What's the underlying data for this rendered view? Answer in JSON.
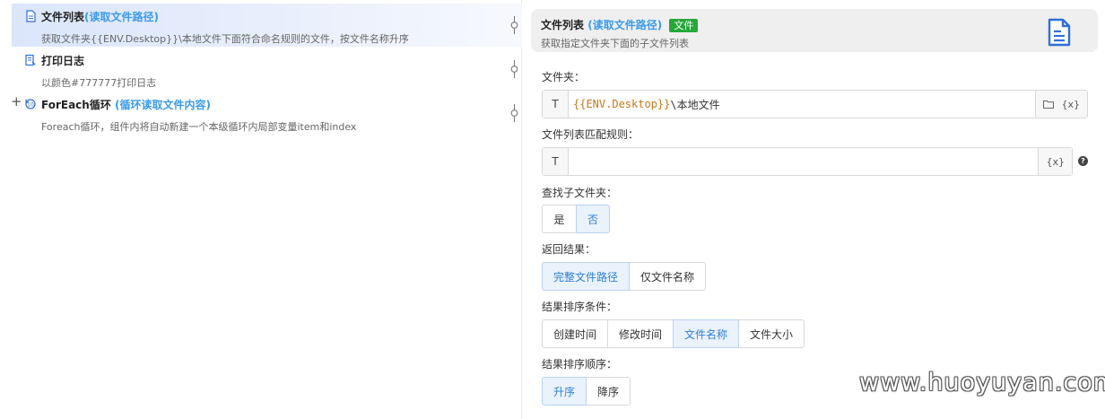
{
  "steps": [
    {
      "title": "文件列表",
      "title_hl": "(读取文件路径)",
      "desc": "获取文件夹{{ENV.Desktop}}\\本地文件下面符合命名规则的文件，按文件名称升序",
      "icon": "file-list-icon",
      "selected": true
    },
    {
      "title": "打印日志",
      "title_hl": "",
      "desc": "以颜色#777777打印日志",
      "icon": "print-log-icon",
      "selected": false
    },
    {
      "title": "ForEach循环",
      "title_hl": " (循环读取文件内容)",
      "desc": "Foreach循环，组件内将自动新建一个本级循环内局部变量item和index",
      "icon": "loop-icon",
      "selected": false,
      "expand": "+"
    }
  ],
  "panel": {
    "title": "文件列表",
    "title_hl": "(读取文件路径)",
    "badge": "文件",
    "subtitle": "获取指定文件夹下面的子文件列表",
    "icon": "document-icon",
    "folder": {
      "label": "文件夹：",
      "prefix": "T",
      "value_env": "{{ENV.Desktop}}",
      "value_rest": "\\本地文件",
      "var_label": "{x}",
      "folder_icon": "folder-icon"
    },
    "rule": {
      "label": "文件列表匹配规则：",
      "prefix": "T",
      "value": "",
      "var_label": "{x}",
      "help": "?"
    },
    "subfolder": {
      "label": "查找子文件夹：",
      "options": [
        "是",
        "否"
      ],
      "selected": 1
    },
    "result": {
      "label": "返回结果：",
      "options": [
        "完整文件路径",
        "仅文件名称"
      ],
      "selected": 0
    },
    "sort_by": {
      "label": "结果排序条件：",
      "options": [
        "创建时间",
        "修改时间",
        "文件名称",
        "文件大小"
      ],
      "selected": 2
    },
    "sort_order": {
      "label": "结果排序顺序：",
      "options": [
        "升序",
        "降序"
      ],
      "selected": 0
    }
  },
  "watermark": "www.huoyuyan.com",
  "colors": {
    "accent": "#3a9be8",
    "badge": "#25a73a",
    "env_var": "#c7781e",
    "selected_bg": "#dbe6fb"
  }
}
